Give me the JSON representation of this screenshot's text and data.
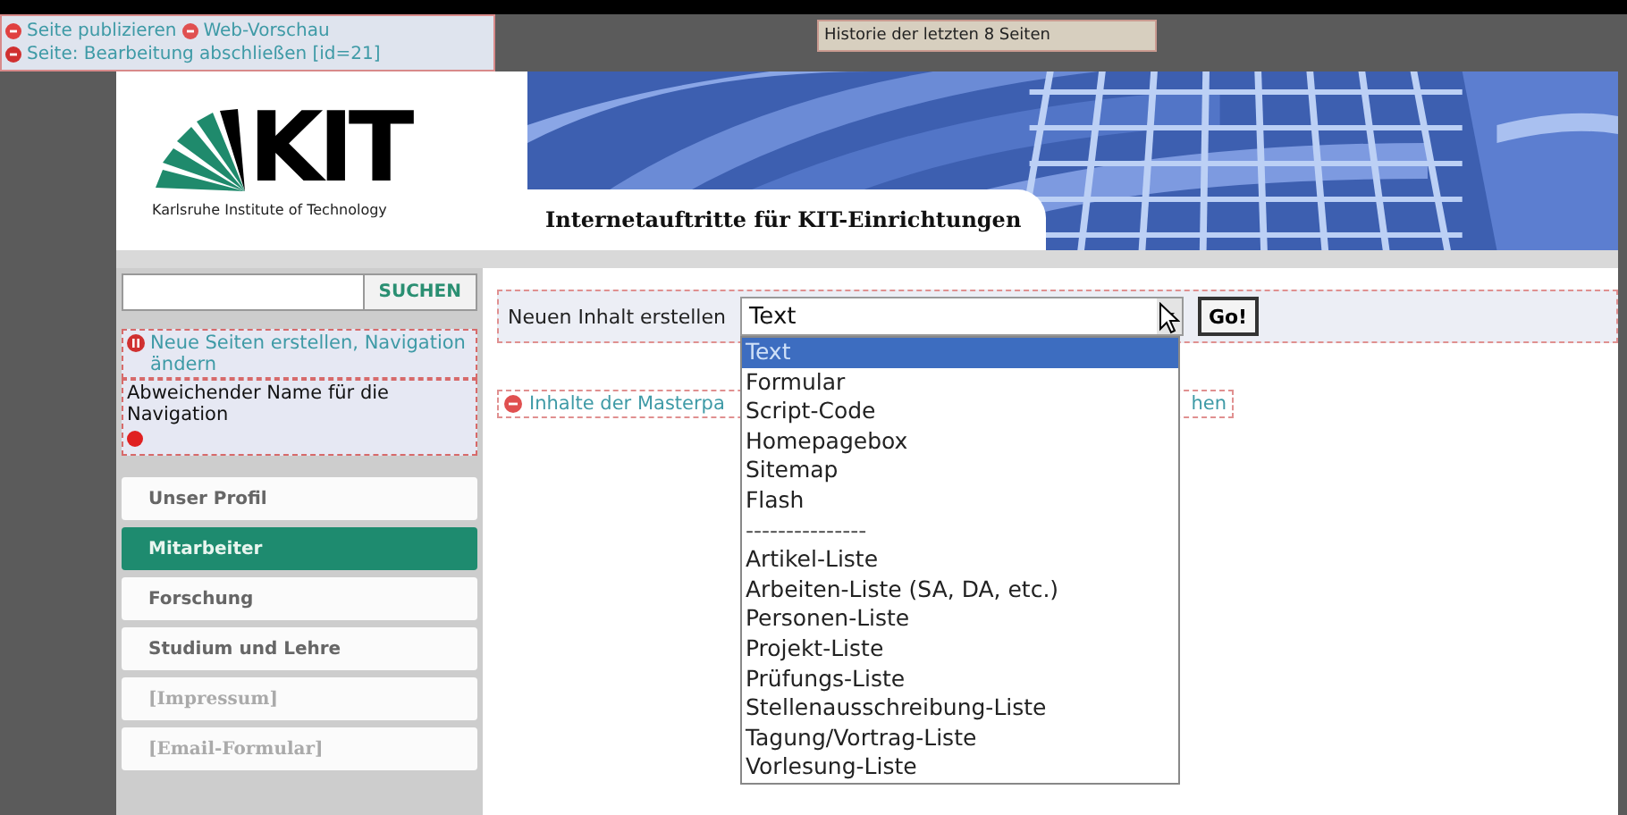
{
  "cms_bar": {
    "links": [
      {
        "kind": "publish",
        "label": "Seite publizieren"
      },
      {
        "kind": "preview",
        "label": "Web-Vorschau"
      },
      {
        "kind": "finish",
        "label": "Seite: Bearbeitung abschließen [id=21]"
      }
    ]
  },
  "history": "Historie der letzten 8 Seiten",
  "logo": {
    "letters": "KIT",
    "subtitle": "Karlsruhe Institute of Technology"
  },
  "site_title": "Internetauftritte für KIT-Einrichtungen",
  "search": {
    "button": "SUCHEN"
  },
  "sidebar": {
    "cms_link": "Neue Seiten erstellen, Navigation ändern",
    "alt_name_note": "Abweichender Name für die Navigation",
    "nav": [
      {
        "label": "Unser Profil",
        "selected": false,
        "disabled": false
      },
      {
        "label": "Mitarbeiter",
        "selected": true,
        "disabled": false
      },
      {
        "label": "Forschung",
        "selected": false,
        "disabled": false
      },
      {
        "label": "Studium und Lehre",
        "selected": false,
        "disabled": false
      },
      {
        "label": "[Impressum]",
        "selected": false,
        "disabled": true
      },
      {
        "label": "[Email-Formular]",
        "selected": false,
        "disabled": true
      }
    ]
  },
  "content": {
    "create_label": "Neuen Inhalt erstellen",
    "select_value": "Text",
    "go": "Go!",
    "options": [
      {
        "kind": "option",
        "label": "Text",
        "selected": true
      },
      {
        "kind": "option",
        "label": "Formular",
        "selected": false
      },
      {
        "kind": "option",
        "label": "Script-Code",
        "selected": false
      },
      {
        "kind": "option",
        "label": "Homepagebox",
        "selected": false
      },
      {
        "kind": "option",
        "label": "Sitemap",
        "selected": false
      },
      {
        "kind": "option",
        "label": "Flash",
        "selected": false
      },
      {
        "kind": "separator",
        "label": "---------------",
        "selected": false
      },
      {
        "kind": "option",
        "label": "Artikel-Liste",
        "selected": false
      },
      {
        "kind": "option",
        "label": "Arbeiten-Liste (SA, DA, etc.)",
        "selected": false
      },
      {
        "kind": "option",
        "label": "Personen-Liste",
        "selected": false
      },
      {
        "kind": "option",
        "label": "Projekt-Liste",
        "selected": false
      },
      {
        "kind": "option",
        "label": "Prüfungs-Liste",
        "selected": false
      },
      {
        "kind": "option",
        "label": "Stellenausschreibung-Liste",
        "selected": false
      },
      {
        "kind": "option",
        "label": "Tagung/Vortrag-Liste",
        "selected": false
      },
      {
        "kind": "option",
        "label": "Vorlesung-Liste",
        "selected": false
      }
    ],
    "master_link": {
      "before": "Inhalte der Masterpa",
      "after": "hen"
    }
  }
}
